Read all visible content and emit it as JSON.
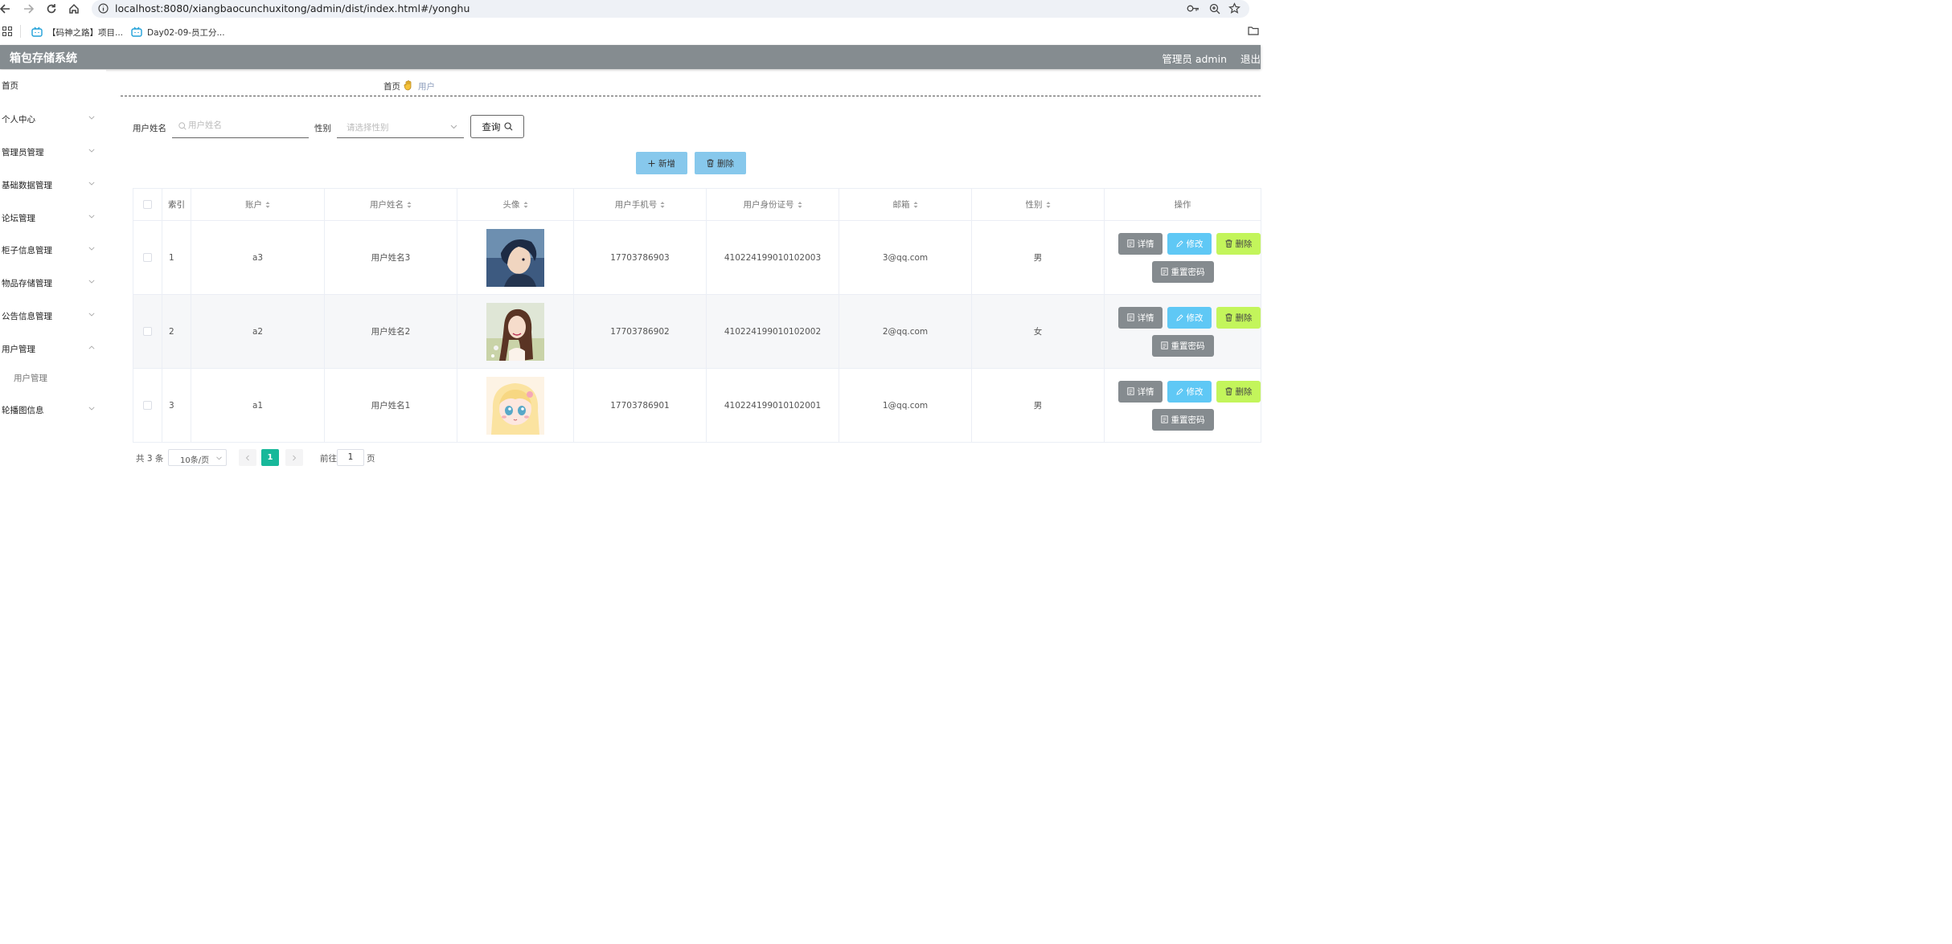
{
  "browser": {
    "url": "localhost:8080/xiangbaocunchuxitong/admin/dist/index.html#/yonghu",
    "bookmarks": [
      {
        "label": "【码神之路】项目..."
      },
      {
        "label": "Day02-09-员工分..."
      }
    ]
  },
  "header": {
    "title": "箱包存储系统",
    "user": "管理员 admin",
    "logout": "退出",
    "bg_color": "#858c90"
  },
  "sidebar": {
    "home": "首页",
    "items": [
      {
        "label": "个人中心",
        "expanded": false
      },
      {
        "label": "管理员管理",
        "expanded": false
      },
      {
        "label": "基础数据管理",
        "expanded": false
      },
      {
        "label": "论坛管理",
        "expanded": false
      },
      {
        "label": "柜子信息管理",
        "expanded": false
      },
      {
        "label": "物品存储管理",
        "expanded": false
      },
      {
        "label": "公告信息管理",
        "expanded": false
      },
      {
        "label": "用户管理",
        "expanded": true
      },
      {
        "label": "轮播图信息",
        "expanded": false
      }
    ],
    "sub_item": "用户管理"
  },
  "breadcrumb": {
    "home": "首页",
    "current": "用户"
  },
  "search": {
    "name_label": "用户姓名",
    "name_placeholder": "用户姓名",
    "gender_label": "性别",
    "gender_placeholder": "请选择性别",
    "query_label": "查询"
  },
  "actions": {
    "add_label": "新增",
    "delete_label": "删除"
  },
  "table": {
    "headers": {
      "index": "索引",
      "account": "账户",
      "name": "用户姓名",
      "avatar": "头像",
      "phone": "用户手机号",
      "id_card": "用户身份证号",
      "email": "邮箱",
      "gender": "性别",
      "ops": "操作"
    },
    "rows": [
      {
        "index": "1",
        "account": "a3",
        "name": "用户姓名3",
        "avatar": "avatar-boy-dark",
        "phone": "17703786903",
        "id_card": "410224199010102003",
        "email": "3@qq.com",
        "gender": "男"
      },
      {
        "index": "2",
        "account": "a2",
        "name": "用户姓名2",
        "avatar": "avatar-girl-photo",
        "phone": "17703786902",
        "id_card": "410224199010102002",
        "email": "2@qq.com",
        "gender": "女"
      },
      {
        "index": "3",
        "account": "a1",
        "name": "用户姓名1",
        "avatar": "avatar-anime-girl",
        "phone": "17703786901",
        "id_card": "410224199010102001",
        "email": "1@qq.com",
        "gender": "男"
      }
    ],
    "op_labels": {
      "detail": "详情",
      "edit": "修改",
      "delete": "删除",
      "reset": "重置密码"
    }
  },
  "pagination": {
    "total": "共 3 条",
    "page_size": "10条/页",
    "current_page": "1",
    "goto_prefix": "前往",
    "goto_value": "1",
    "goto_suffix": "页"
  },
  "colors": {
    "accent_teal": "#17b89a",
    "add_button": "#87c8ec",
    "edit_button": "#5fc8f5",
    "delete_button": "#c3f55b",
    "detail_button": "#858b8f"
  }
}
